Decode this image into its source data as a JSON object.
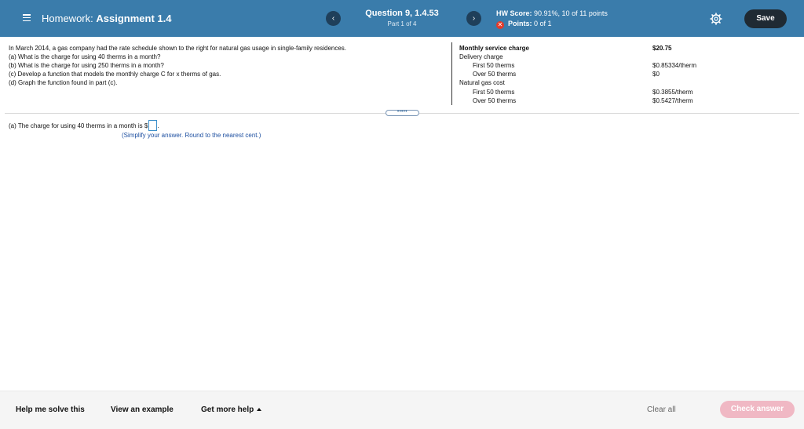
{
  "header": {
    "section_label": "Homework:",
    "assignment_label": "Assignment 1.4",
    "prev_glyph": "‹",
    "next_glyph": "›",
    "question_title": "Question 9, 1.4.53",
    "question_part": "Part 1 of 4",
    "score_label": "HW Score:",
    "score_value": "90.91%, 10 of 11 points",
    "points_label": "Points:",
    "points_value": "0 of 1",
    "save_label": "Save"
  },
  "problem": {
    "lines": [
      "In March 2014, a gas company had the rate schedule shown to the right for natural gas usage in single-family residences.",
      "(a) What is the charge for using 40 therms in a month?",
      "(b) What is the charge for using 250 therms in a month?",
      "(c) Develop a function that models the monthly charge C for x therms of gas.",
      "(d) Graph the function found in part (c)."
    ]
  },
  "rate_schedule": {
    "rows": [
      {
        "label": "Monthly service charge",
        "value": "$20.75"
      },
      {
        "label": "Delivery charge",
        "value": ""
      },
      {
        "label": "First 50 therms",
        "value": "$0.85334/therm"
      },
      {
        "label": "Over 50 therms",
        "value": "$0"
      },
      {
        "label": "Natural gas cost",
        "value": ""
      },
      {
        "label": "First 50 therms",
        "value": "$0.3855/therm"
      },
      {
        "label": "Over 50 therms",
        "value": "$0.5427/therm"
      }
    ]
  },
  "expander_label": "•••••",
  "answer": {
    "prompt": "(a) The charge for using 40 therms in a month is $",
    "suffix": ".",
    "value": "",
    "hint": "(Simplify your answer. Round to the nearest cent.)"
  },
  "footer": {
    "help_label": "Help me solve this",
    "example_label": "View an example",
    "more_help_label": "Get more help",
    "clear_label": "Clear all",
    "check_label": "Check answer"
  },
  "colors": {
    "header_bg": "#3a7cab",
    "check_button_disabled": "#f0b8c4",
    "points_error": "#e23a2a"
  },
  "icons": [
    "menu-icon",
    "chevron-left-icon",
    "chevron-right-icon",
    "x-circle-icon",
    "gear-icon",
    "caret-up-icon"
  ]
}
